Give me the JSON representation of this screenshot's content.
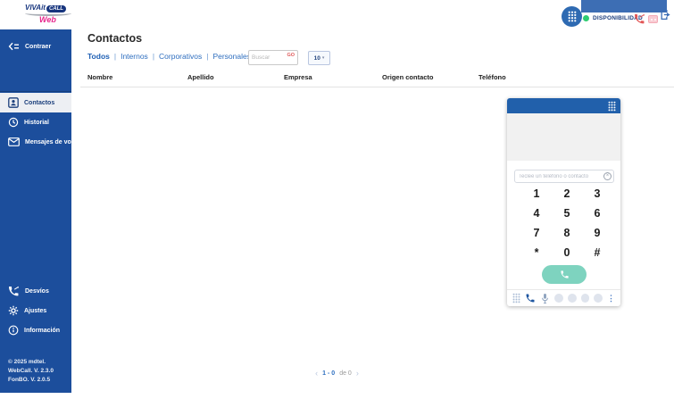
{
  "header": {
    "logo": {
      "part1": "VIVAit",
      "badge": "CALL",
      "part2": "Web"
    },
    "availability_label": "DISPONIBILIDAD"
  },
  "sidebar": {
    "collapse_label": "Contraer",
    "items": [
      {
        "label": "Contactos"
      },
      {
        "label": "Historial"
      },
      {
        "label": "Mensajes de voz"
      }
    ],
    "items_bottom": [
      {
        "label": "Desvíos"
      },
      {
        "label": "Ajustes"
      },
      {
        "label": "Información"
      }
    ],
    "footer": [
      "© 2025 mdtel.",
      "WebCall. V. 2.3.0",
      "FonBO. V. 2.0.5"
    ]
  },
  "main": {
    "title": "Contactos",
    "filters": [
      "Todos",
      "Internos",
      "Corporativos",
      "Personales"
    ],
    "search": {
      "placeholder": "Buscar",
      "go_label": "GO"
    },
    "page_size": "10",
    "table": {
      "columns": [
        "Nombre",
        "Apellido",
        "Empresa",
        "Origen contacto",
        "Teléfono"
      ],
      "rows": []
    },
    "pagination": {
      "range": "1 - 0",
      "of": "de 0"
    }
  },
  "dialpad": {
    "input_placeholder": "Teclee un teléfono o contacto",
    "keys": [
      "1",
      "2",
      "3",
      "4",
      "5",
      "6",
      "7",
      "8",
      "9",
      "*",
      "0",
      "#"
    ]
  },
  "glyphs": {
    "caret": "▾",
    "ellipsis": "⋮",
    "clear": "×",
    "prev": "‹",
    "next": "›",
    "pipe": "|"
  },
  "colors": {
    "sidebar_blue": "#1c4e9c",
    "widget_header_blue": "#2160ab",
    "link_blue": "#2e6ebf",
    "go_red": "#e05a5a",
    "status_green": "#2ecc71",
    "call_teal": "#7ed3bf"
  }
}
